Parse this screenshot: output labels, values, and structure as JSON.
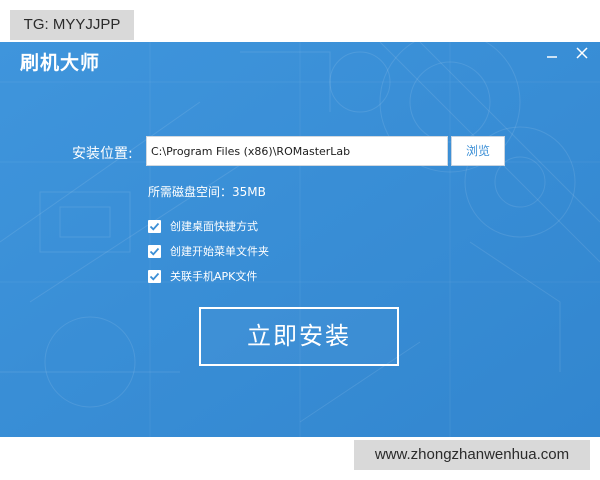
{
  "watermark_top": "TG: MYYJJPP",
  "watermark_bottom": "www.zhongzhanwenhua.com",
  "window": {
    "title": "刷机大师",
    "minimize_symbol": "—",
    "close_symbol": "✕"
  },
  "install": {
    "location_label": "安装位置:",
    "path_value": "C:\\Program Files (x86)\\ROMasterLab",
    "browse_label": "浏览",
    "space_text": "所需磁盘空间：35MB",
    "options": [
      {
        "label": "创建桌面快捷方式",
        "checked": true
      },
      {
        "label": "创建开始菜单文件夹",
        "checked": true
      },
      {
        "label": "关联手机APK文件",
        "checked": true
      }
    ],
    "install_button": "立即安装"
  },
  "colors": {
    "window_bg": "#3b8fd6",
    "watermark_bg": "#d9d9d9",
    "check_mark": "#3b8fd6"
  },
  "icons": {
    "minimize": "minimize-icon",
    "close": "close-icon",
    "check": "checkmark-icon"
  }
}
